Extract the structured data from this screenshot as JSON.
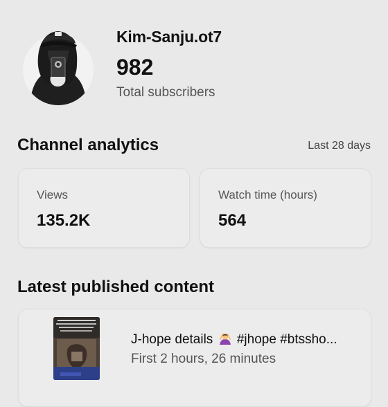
{
  "channel": {
    "name": "Kim-Sanju.ot7",
    "subscriber_count": "982",
    "subscriber_label": "Total subscribers",
    "avatar_icon": "hooded-person-selfie-avatar"
  },
  "analytics": {
    "title": "Channel analytics",
    "period": "Last 28 days",
    "stats": [
      {
        "label": "Views",
        "value": "135.2K"
      },
      {
        "label": "Watch time (hours)",
        "value": "564"
      }
    ]
  },
  "latest": {
    "title": "Latest published content",
    "video": {
      "title_prefix": "J-hope details",
      "emoji_icon": "person-gesturing-ok-emoji",
      "title_suffix": "#jhope #btssho...",
      "meta": "First 2 hours, 26 minutes"
    }
  },
  "colors": {
    "background": "#e9e9e9",
    "card": "#ececec",
    "secondary_text": "#555555"
  }
}
